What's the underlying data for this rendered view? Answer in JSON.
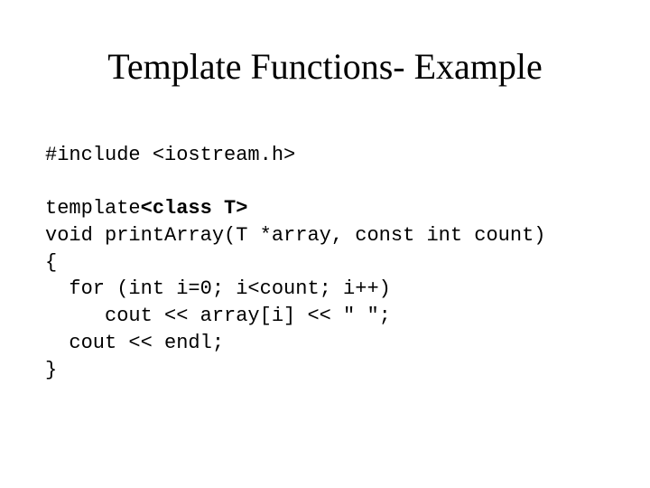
{
  "title": "Template Functions- Example",
  "code": {
    "line1": "#include <iostream.h>",
    "blank1": "",
    "line2_pre": "template",
    "line2_bold": "<class T>",
    "line3": "void printArray(T *array, const int count)",
    "line4": "{",
    "line5": "  for (int i=0; i<count; i++)",
    "line6": "     cout << array[i] << \" \";",
    "line7": "  cout << endl;",
    "line8": "}"
  }
}
